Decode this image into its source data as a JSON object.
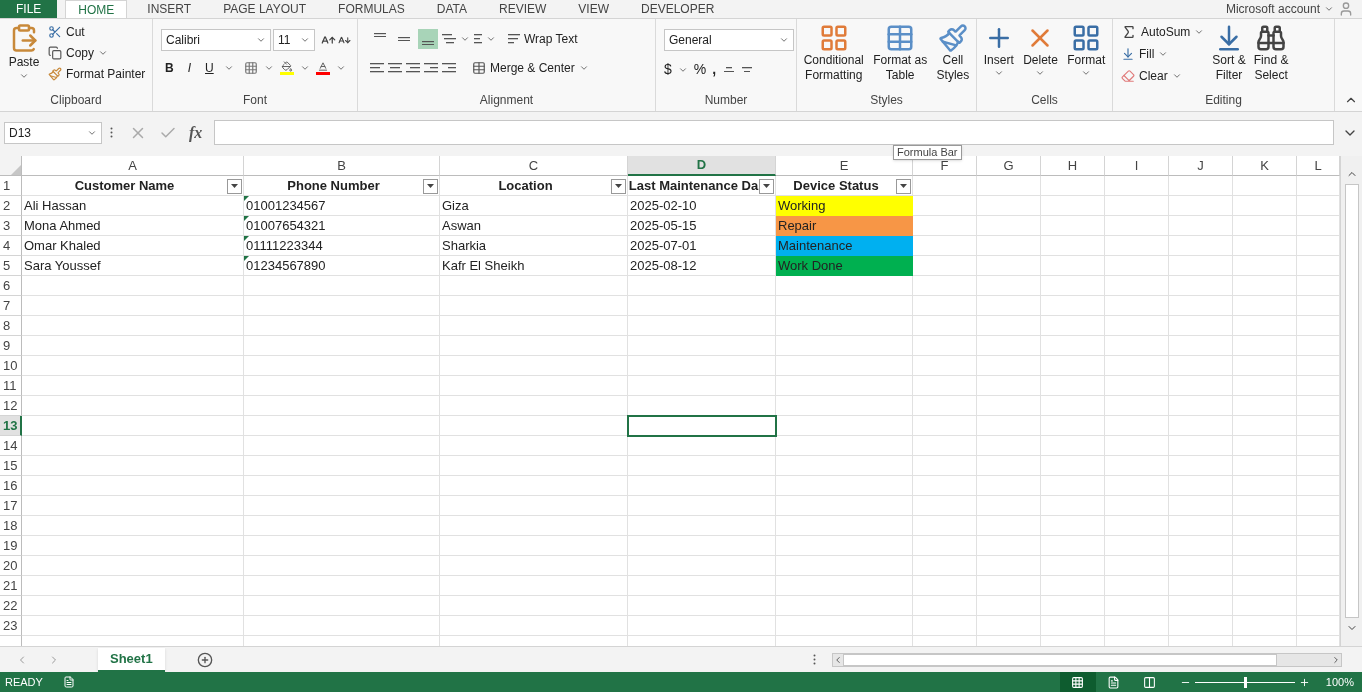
{
  "tabs": [
    {
      "label": "FILE",
      "kind": "file",
      "selected": false
    },
    {
      "label": "HOME",
      "kind": "tab",
      "selected": true
    },
    {
      "label": "INSERT",
      "kind": "tab",
      "selected": false
    },
    {
      "label": "PAGE LAYOUT",
      "kind": "tab",
      "selected": false
    },
    {
      "label": "FORMULAS",
      "kind": "tab",
      "selected": false
    },
    {
      "label": "DATA",
      "kind": "tab",
      "selected": false
    },
    {
      "label": "REVIEW",
      "kind": "tab",
      "selected": false
    },
    {
      "label": "VIEW",
      "kind": "tab",
      "selected": false
    },
    {
      "label": "DEVELOPER",
      "kind": "tab",
      "selected": false
    }
  ],
  "account": "Microsoft account",
  "ribbon": {
    "clipboard": {
      "label": "Clipboard",
      "paste": "Paste",
      "cut": "Cut",
      "copy": "Copy",
      "format_painter": "Format Painter"
    },
    "font": {
      "label": "Font",
      "name": "Calibri",
      "size": "11",
      "bold": "B",
      "italic": "I",
      "underline": "U"
    },
    "alignment": {
      "label": "Alignment",
      "vertical": [
        {
          "selected": false
        },
        {
          "selected": false
        },
        {
          "selected": true
        }
      ],
      "wrap_text": "Wrap Text",
      "merge": "Merge & Center"
    },
    "number": {
      "label": "Number",
      "format": "General",
      "currency": "$",
      "percent": "%",
      "comma": ","
    },
    "styles": {
      "label": "Styles",
      "buttons": [
        {
          "lines": [
            "Conditional",
            "Formatting"
          ],
          "kind": "conditional"
        },
        {
          "lines": [
            "Format as",
            "Table"
          ],
          "kind": "table"
        },
        {
          "lines": [
            "Cell",
            "Styles"
          ],
          "kind": "cellstyles"
        }
      ]
    },
    "cells": {
      "label": "Cells",
      "buttons": [
        {
          "label": "Insert",
          "kind": "insert"
        },
        {
          "label": "Delete",
          "kind": "delete"
        },
        {
          "label": "Format",
          "kind": "format"
        }
      ]
    },
    "editing": {
      "label": "Editing",
      "autosum": "AutoSum",
      "fill": "Fill",
      "clear": "Clear",
      "sort": [
        "Sort &",
        "Filter"
      ],
      "find": [
        "Find &",
        "Select"
      ]
    }
  },
  "formula_bar": {
    "name_box": "D13",
    "fx": "fx"
  },
  "tooltip": "Formula Bar",
  "sheet": {
    "columns": [
      {
        "label": "A",
        "selected": false
      },
      {
        "label": "B",
        "selected": false
      },
      {
        "label": "C",
        "selected": false
      },
      {
        "label": "D",
        "selected": true
      },
      {
        "label": "E",
        "selected": false
      },
      {
        "label": "F",
        "selected": false
      },
      {
        "label": "G",
        "selected": false
      },
      {
        "label": "H",
        "selected": false
      },
      {
        "label": "I",
        "selected": false
      },
      {
        "label": "J",
        "selected": false
      },
      {
        "label": "K",
        "selected": false
      },
      {
        "label": "L",
        "selected": false
      }
    ],
    "rows": [
      {
        "label": "1",
        "selected": false
      },
      {
        "label": "2",
        "selected": false
      },
      {
        "label": "3",
        "selected": false
      },
      {
        "label": "4",
        "selected": false
      },
      {
        "label": "5",
        "selected": false
      },
      {
        "label": "6",
        "selected": false
      },
      {
        "label": "7",
        "selected": false
      },
      {
        "label": "8",
        "selected": false
      },
      {
        "label": "9",
        "selected": false
      },
      {
        "label": "10",
        "selected": false
      },
      {
        "label": "11",
        "selected": false
      },
      {
        "label": "12",
        "selected": false
      },
      {
        "label": "13",
        "selected": true
      },
      {
        "label": "14",
        "selected": false
      },
      {
        "label": "15",
        "selected": false
      },
      {
        "label": "16",
        "selected": false
      },
      {
        "label": "17",
        "selected": false
      },
      {
        "label": "18",
        "selected": false
      },
      {
        "label": "19",
        "selected": false
      },
      {
        "label": "20",
        "selected": false
      },
      {
        "label": "21",
        "selected": false
      },
      {
        "label": "22",
        "selected": false
      },
      {
        "label": "23",
        "selected": false
      }
    ]
  },
  "table": {
    "headers": [
      "Customer Name",
      "Phone Number",
      "Location",
      "Last Maintenance Da",
      "Device Status"
    ],
    "rows": [
      {
        "cells": [
          "Ali Hassan",
          "01001234567",
          "Giza",
          "2025-02-10"
        ],
        "status": "Working",
        "color": "#ffff00",
        "phone_flag": true
      },
      {
        "cells": [
          "Mona Ahmed",
          "01007654321",
          "Aswan",
          "2025-05-15"
        ],
        "status": "Repair",
        "color": "#f79646",
        "phone_flag": true
      },
      {
        "cells": [
          "Omar Khaled",
          "01111223344",
          "Sharkia",
          "2025-07-01"
        ],
        "status": "Maintenance",
        "color": "#00b0f0",
        "phone_flag": true
      },
      {
        "cells": [
          "Sara Youssef",
          "01234567890",
          "Kafr El Sheikh",
          "2025-08-12"
        ],
        "status": "Work Done",
        "color": "#00b050",
        "phone_flag": true
      }
    ]
  },
  "sheet_tabs": [
    {
      "label": "Sheet1",
      "selected": true
    }
  ],
  "status_bar": {
    "ready": "READY",
    "zoom": "100%",
    "zoom_level": {
      "level": 0.5
    },
    "views": [
      {
        "kind": "normal",
        "selected": true
      },
      {
        "kind": "page",
        "selected": false
      },
      {
        "kind": "break",
        "selected": false
      }
    ]
  }
}
